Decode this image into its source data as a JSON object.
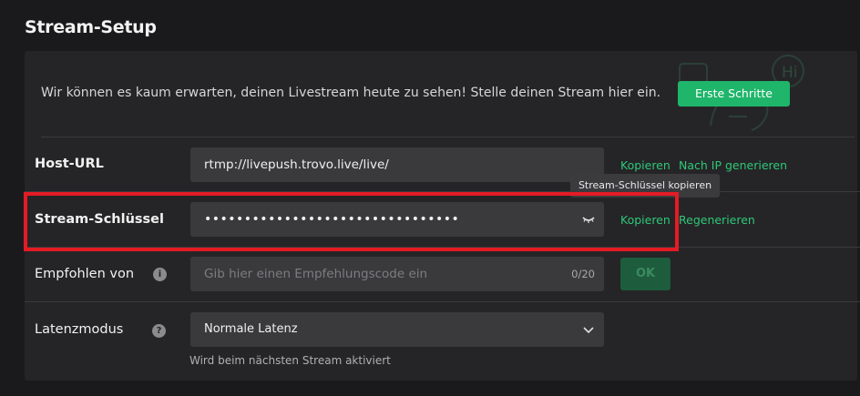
{
  "page": {
    "title": "Stream-Setup"
  },
  "banner": {
    "text": "Wir können es kaum erwarten, deinen Livestream heute zu sehen! Stelle deinen Stream hier ein.",
    "button_label": "Erste Schritte",
    "mascot_greeting": "Hi"
  },
  "host_url": {
    "label": "Host-URL",
    "value": "rtmp://livepush.trovo.live/live/",
    "copy_label": "Kopieren",
    "generate_label": "Nach IP generieren"
  },
  "stream_key": {
    "label": "Stream-Schlüssel",
    "value": "••••••••••••••••••••••••••••••••",
    "copy_label": "Kopieren",
    "regenerate_label": "Regenerieren",
    "tooltip": "Stream-Schlüssel kopieren"
  },
  "referral": {
    "label": "Empfohlen von",
    "placeholder": "Gib hier einen Empfehlungscode ein",
    "counter": "0/20",
    "ok_label": "OK"
  },
  "latency": {
    "label": "Latenzmodus",
    "selected": "Normale Latenz",
    "hint": "Wird beim nächsten Stream aktiviert"
  },
  "colors": {
    "accent": "#1fb56b",
    "link": "#2ec878",
    "highlight": "#e51b24"
  },
  "icons": {
    "eye_closed": "eye-closed-icon",
    "info": "info-icon",
    "help": "question-icon",
    "chevron": "chevron-down-icon"
  }
}
